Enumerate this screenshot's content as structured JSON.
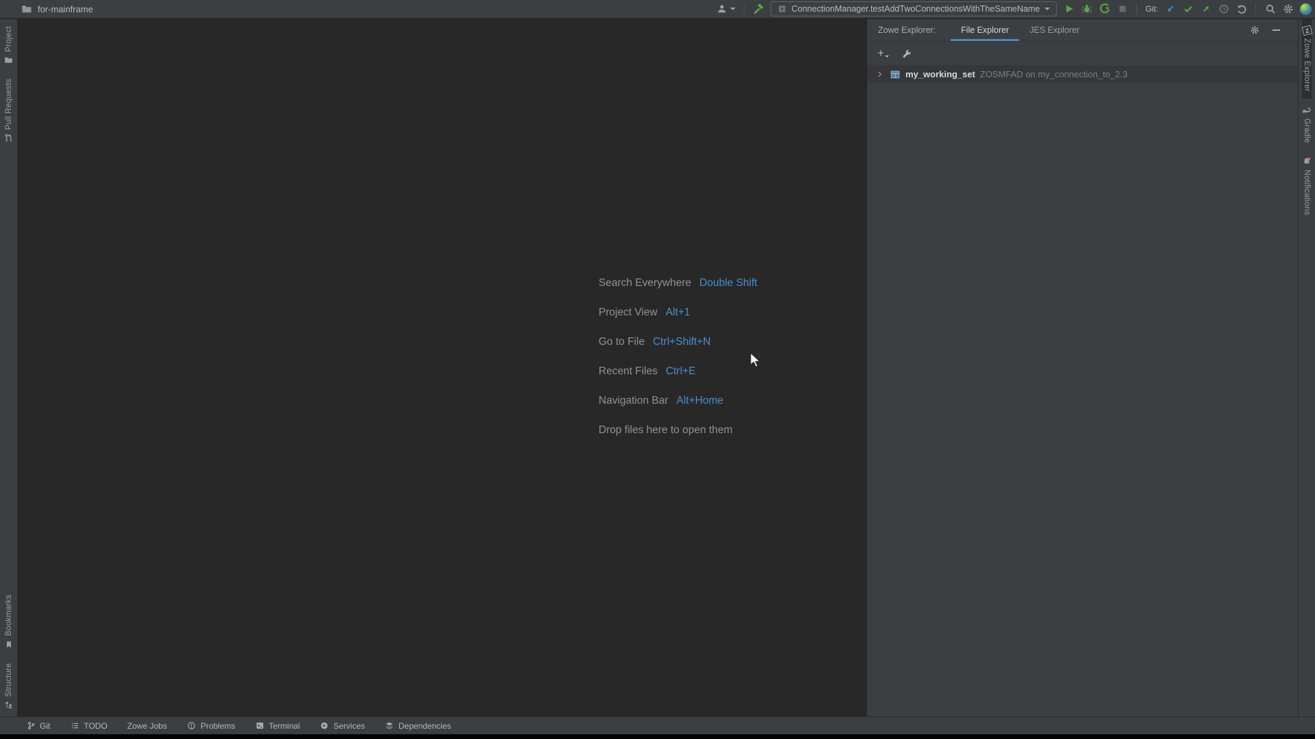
{
  "window": {
    "title": "for-mainframe"
  },
  "toolbar": {
    "run_configuration": "ConnectionManager.testAddTwoConnectionsWithTheSameName",
    "git_label": "Git:"
  },
  "left_stripe": {
    "top": [
      {
        "label": "Project"
      },
      {
        "label": "Pull Requests"
      }
    ],
    "bottom": [
      {
        "label": "Bookmarks"
      },
      {
        "label": "Structure"
      }
    ]
  },
  "right_stripe": {
    "items": [
      {
        "label": "Zowe Explorer"
      },
      {
        "label": "Gradle"
      },
      {
        "label": "Notifications"
      }
    ]
  },
  "editor_hints": {
    "items": [
      {
        "label": "Search Everywhere",
        "shortcut": "Double Shift"
      },
      {
        "label": "Project View",
        "shortcut": "Alt+1"
      },
      {
        "label": "Go to File",
        "shortcut": "Ctrl+Shift+N"
      },
      {
        "label": "Recent Files",
        "shortcut": "Ctrl+E"
      },
      {
        "label": "Navigation Bar",
        "shortcut": "Alt+Home"
      }
    ],
    "drop_hint": "Drop files here to open them"
  },
  "zowe_panel": {
    "title": "Zowe Explorer:",
    "tabs": [
      {
        "label": "File Explorer",
        "selected": true
      },
      {
        "label": "JES Explorer",
        "selected": false
      }
    ],
    "tree": [
      {
        "name": "my_working_set",
        "detail": "ZOSMFAD on my_connection_to_2.3"
      }
    ]
  },
  "status_bar": {
    "items": [
      {
        "label": "Git"
      },
      {
        "label": "TODO"
      },
      {
        "label": "Zowe Jobs"
      },
      {
        "label": "Problems"
      },
      {
        "label": "Terminal"
      },
      {
        "label": "Services"
      },
      {
        "label": "Dependencies"
      }
    ]
  },
  "colors": {
    "panel_bg": "#3c3f41",
    "editor_bg": "#282829",
    "accent_blue": "#4a88c7",
    "shortcut_blue": "#4c8ecb",
    "action_green": "#57a64a",
    "vcs_update_blue": "#3f8ecf",
    "notification_red": "#e05e5e"
  }
}
